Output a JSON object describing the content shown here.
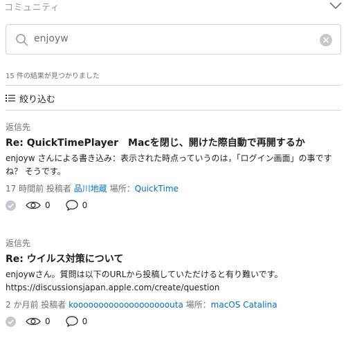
{
  "header": {
    "title": "コミュニティ"
  },
  "search": {
    "value": "enjoyw"
  },
  "results_count": "15 件の結果が見つかりました",
  "filter": {
    "label": "絞り込む"
  },
  "results": [
    {
      "kind": "返信先",
      "title": "Re: QuickTimePlayer　Macを閉じ、開けた際自動で再開するか",
      "author_prefix": "enjoyw",
      "excerpt": " さんによる書き込み：表示された時点っていうのは，「ログイン画面」の事ですね？ そうです。",
      "time": "17 時間前",
      "posted_by_label": "投稿者",
      "poster": "品川地蔵",
      "place_label": "場所：",
      "place": "QuickTime",
      "views": "0",
      "replies": "0"
    },
    {
      "kind": "返信先",
      "title": "Re: ウイルス対策について",
      "excerpt_line1": "enjoywさん。質問は以下のURLから投稿していただけると有り難いです。",
      "excerpt_line2": "https://discussionsjapan.apple.com/create/question",
      "time": "2 か月前",
      "posted_by_label": "投稿者",
      "poster": "kooooooooooooooooooouta",
      "place_label": "場所：",
      "place": "macOS Catalina",
      "views": "0",
      "replies": "0"
    }
  ],
  "colors": {
    "link": "#0070c9",
    "muted": "#6e6e73",
    "border": "#d2d2d7",
    "icon_gray": "#c7c7cc"
  }
}
